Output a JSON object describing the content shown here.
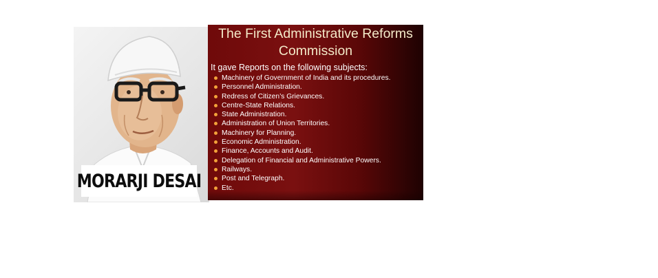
{
  "portrait": {
    "name_caption": "MORARJI DESAI"
  },
  "slide": {
    "title": "The First Administrative Reforms Commission",
    "intro": "It gave Reports on the following subjects:",
    "subjects": [
      "Machinery of Government of India and its procedures.",
      "Personnel Administration.",
      "Redress of Citizen’s Grievances.",
      "Centre-State Relations.",
      "State Administration.",
      "Administration of Union Territories.",
      "Machinery for Planning.",
      "Economic Administration.",
      "Finance, Accounts and Audit.",
      "Delegation of Financial and Administrative Powers.",
      "Railways.",
      "Post and Telegraph.",
      "Etc."
    ],
    "bullet_color": "#f2a23a",
    "background_color": "#6f0a0a",
    "title_color": "#f3e9c8"
  }
}
